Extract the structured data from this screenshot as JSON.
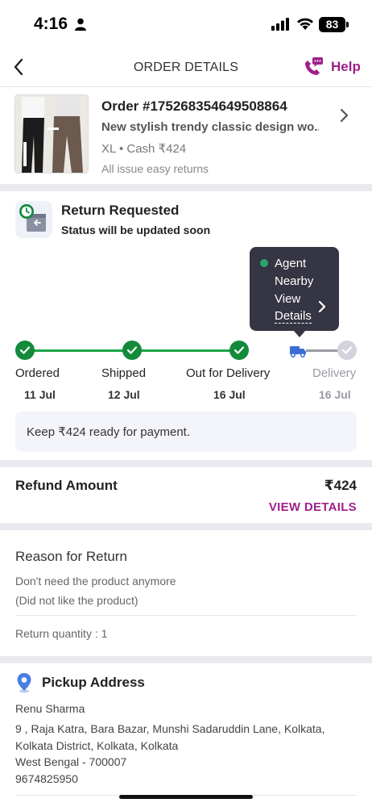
{
  "status_bar": {
    "time": "4:16",
    "battery": "83"
  },
  "header": {
    "title": "ORDER DETAILS",
    "help_label": "Help"
  },
  "order": {
    "order_id": "Order #175268354649508864",
    "product_name": "New stylish trendy classic design wo...",
    "meta": "XL • Cash ₹424",
    "returns_note": "All issue easy returns"
  },
  "return_status": {
    "title": "Return Requested",
    "subtitle": "Status will be updated soon",
    "tooltip": {
      "line1": "Agent",
      "line2": "Nearby",
      "line3": "View",
      "link": "Details"
    }
  },
  "timeline": {
    "steps": [
      {
        "label": "Ordered",
        "date": "11 Jul",
        "done": true
      },
      {
        "label": "Shipped",
        "date": "12 Jul",
        "done": true
      },
      {
        "label": "Out for Delivery",
        "date": "16 Jul",
        "done": true
      },
      {
        "label": "Delivery",
        "date": "16 Jul",
        "done": false
      }
    ]
  },
  "payment_note": "Keep ₹424 ready for payment.",
  "refund": {
    "label": "Refund Amount",
    "amount": "₹424",
    "link": "VIEW DETAILS"
  },
  "reason": {
    "heading": "Reason for Return",
    "line1": "Don't need the product anymore",
    "line2": "(Did not like the product)",
    "quantity": "Return quantity : 1"
  },
  "pickup": {
    "heading": "Pickup Address",
    "name": "Renu Sharma",
    "address_lines": [
      "9 , Raja Katra, Bara Bazar, Munshi Sadaruddin Lane, Kolkata,",
      "Kolkata District, Kolkata, Kolkata",
      "West Bengal - 700007",
      "9674825950"
    ]
  },
  "colors": {
    "brand": "#9f2089",
    "success": "#138a3c",
    "tooltip_bg": "#353543"
  }
}
